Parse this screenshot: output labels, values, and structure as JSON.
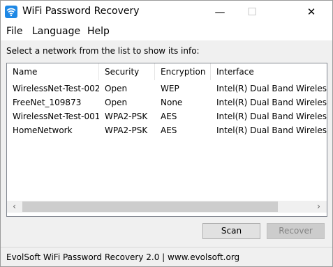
{
  "window": {
    "title": "WiFi Password Recovery",
    "minimize_glyph": "—",
    "maximize_glyph": "☐",
    "close_glyph": "✕"
  },
  "menu": {
    "file": "File",
    "language": "Language",
    "help": "Help"
  },
  "instruction": "Select a network from the list to show its info:",
  "table": {
    "columns": [
      "Name",
      "Security",
      "Encryption",
      "Interface"
    ],
    "rows": [
      [
        "WirelessNet-Test-002",
        "Open",
        "WEP",
        "Intel(R) Dual Band Wireless"
      ],
      [
        "FreeNet_109873",
        "Open",
        "None",
        "Intel(R) Dual Band Wireless"
      ],
      [
        "WirelessNet-Test-001",
        "WPA2-PSK",
        "AES",
        "Intel(R) Dual Band Wireless"
      ],
      [
        "HomeNetwork",
        "WPA2-PSK",
        "AES",
        "Intel(R) Dual Band Wireless"
      ]
    ]
  },
  "scrollbar": {
    "left_arrow": "‹",
    "right_arrow": "›"
  },
  "buttons": {
    "scan": "Scan",
    "recover": "Recover"
  },
  "status": "EvolSoft WiFi Password Recovery 2.0 | www.evolsoft.org",
  "colors": {
    "app_icon": "#1e88e5",
    "disabled_text": "#838383"
  },
  "icons": {
    "app": "wifi-icon",
    "minimize": "minimize-icon",
    "maximize": "maximize-icon",
    "close": "close-icon"
  }
}
